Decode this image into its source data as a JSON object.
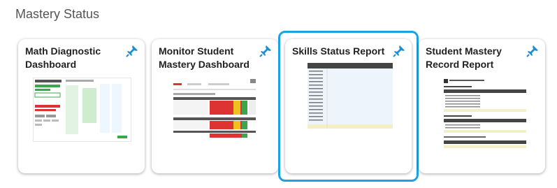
{
  "section": {
    "title": "Mastery Status"
  },
  "cards": [
    {
      "title": "Math Diagnostic Dashboard",
      "icon": "pin-icon"
    },
    {
      "title": "Monitor Student Mastery Dashboard",
      "icon": "pin-icon"
    },
    {
      "title": "Skills Status Report",
      "icon": "pin-icon",
      "selected": true
    },
    {
      "title": "Student Mastery Record Report",
      "icon": "pin-icon"
    }
  ],
  "colors": {
    "selected_border": "#1ba3e0",
    "pin": "#1c8fd6"
  }
}
